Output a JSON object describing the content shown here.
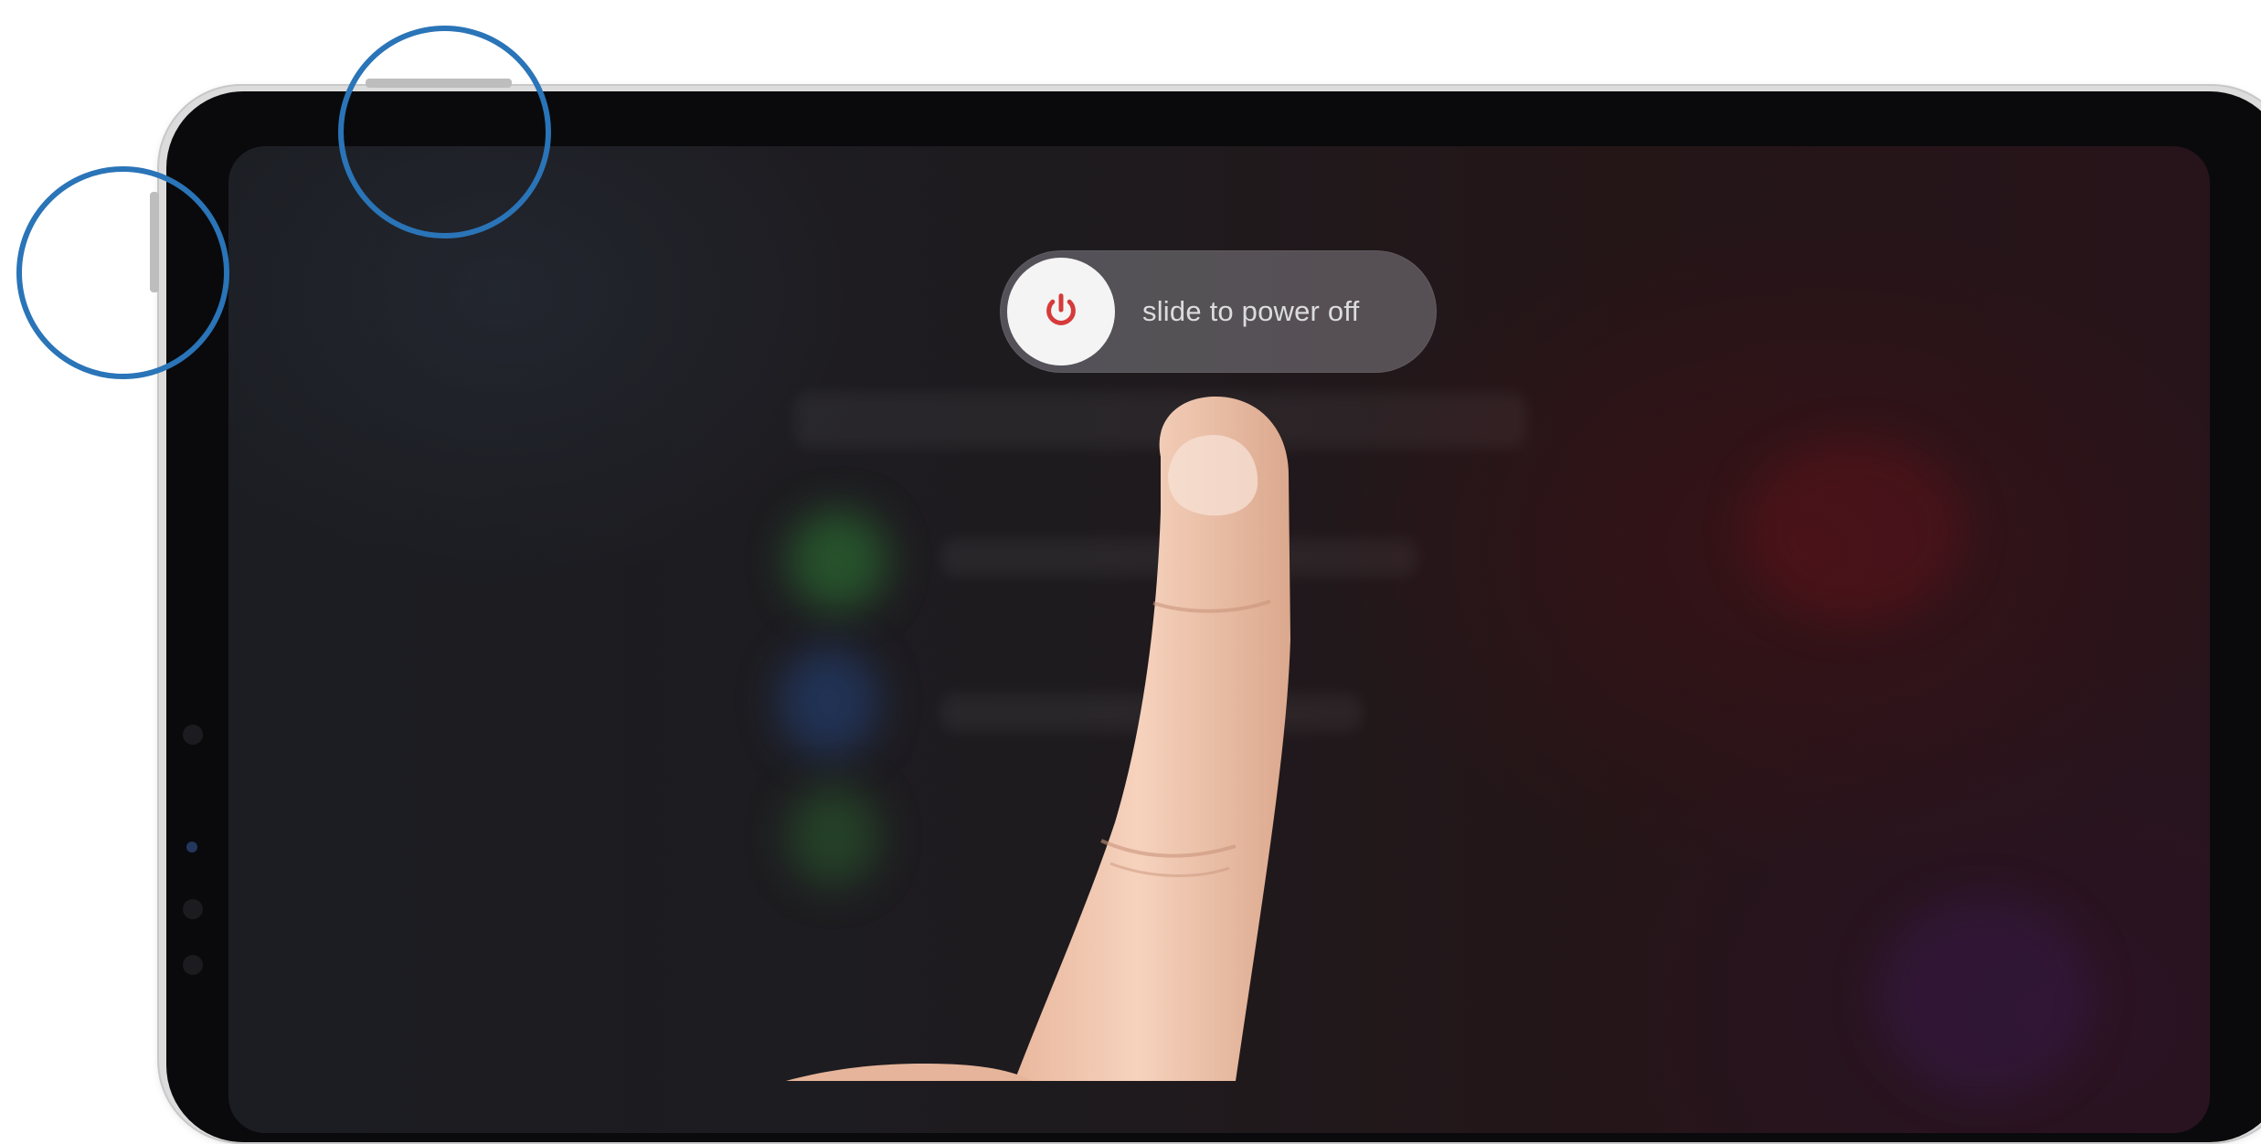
{
  "power_slider": {
    "label": "slide to power off",
    "icon": "power-icon",
    "icon_color": "#d63a3a"
  },
  "annotations": {
    "highlight_color": "#2a74b8"
  }
}
